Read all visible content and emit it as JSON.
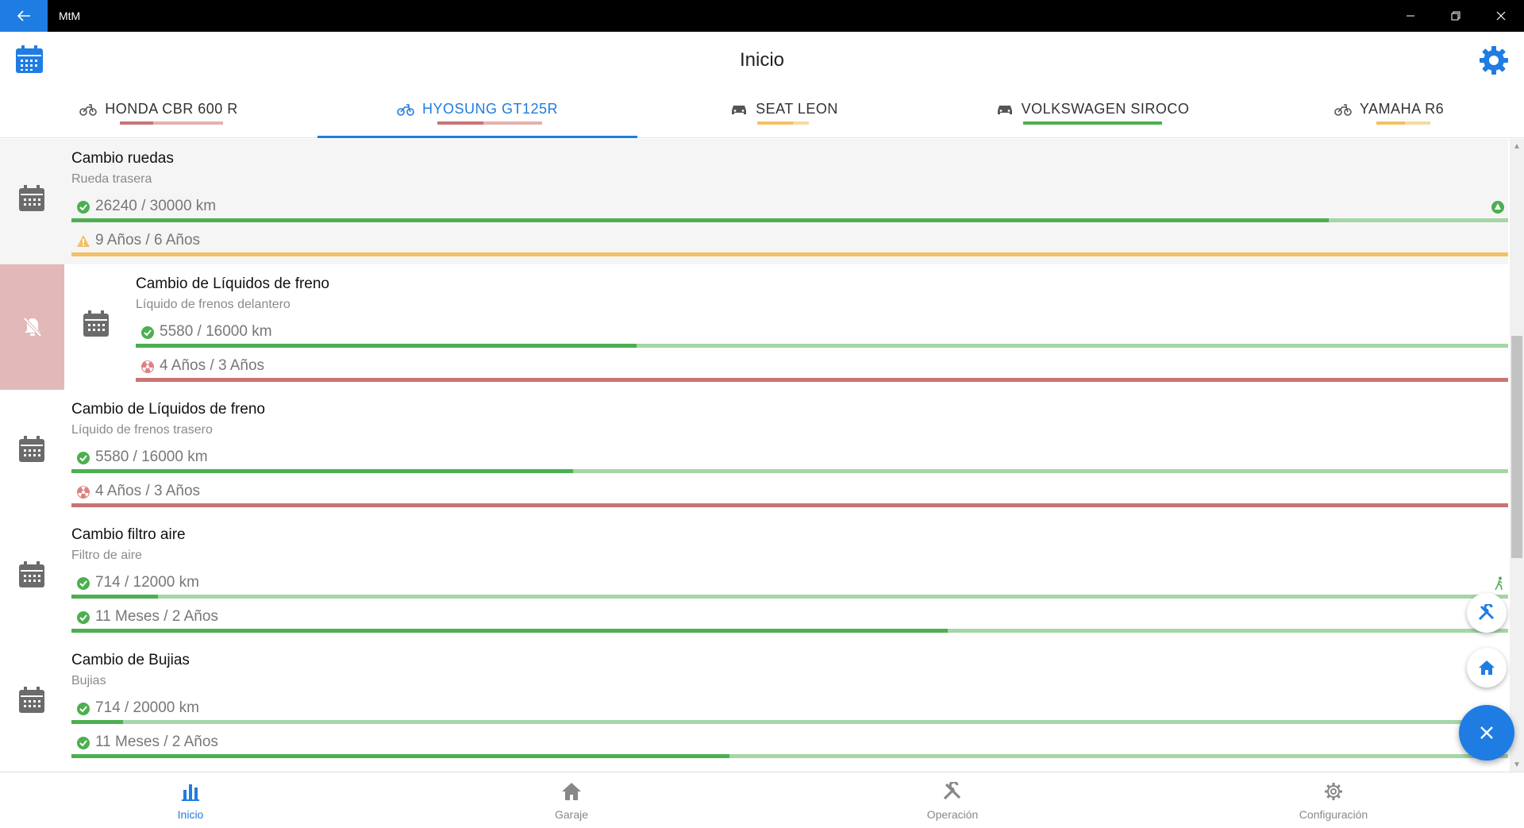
{
  "window": {
    "title": "MtM"
  },
  "header": {
    "title": "Inicio"
  },
  "colors": {
    "accent": "#1f7ce3",
    "ok": "#4caf50",
    "ok_light": "#a5d6a7",
    "warn": "#f4c064",
    "warn_light": "#f7d9a3",
    "danger": "#c87474",
    "danger_light": "#e5b1b1"
  },
  "tabs": [
    {
      "label": "HONDA CBR 600 R",
      "icon": "motorcycle-icon",
      "active": false
    },
    {
      "label": "HYOSUNG GT125R",
      "icon": "motorcycle-icon",
      "active": true
    },
    {
      "label": "SEAT LEON",
      "icon": "car-icon",
      "active": false
    },
    {
      "label": "VOLKSWAGEN SIROCO",
      "icon": "car-icon",
      "active": false
    },
    {
      "label": "YAMAHA R6",
      "icon": "motorcycle-icon",
      "active": false
    }
  ],
  "items": [
    {
      "title": "Cambio ruedas",
      "subtitle": "Rueda trasera",
      "km": {
        "text": "26240 / 30000 km",
        "status": "ok",
        "progress": 0.875
      },
      "time": {
        "text": "9 Años / 6 Años",
        "status": "warn",
        "progress": 1.0
      }
    },
    {
      "title": "Cambio de Líquidos de freno",
      "subtitle": "Líquido de frenos delantero",
      "km": {
        "text": "5580 / 16000 km",
        "status": "ok",
        "progress": 0.365
      },
      "time": {
        "text": "4 Años / 3 Años",
        "status": "danger",
        "progress": 1.0
      }
    },
    {
      "title": "Cambio de Líquidos de freno",
      "subtitle": "Líquido de frenos trasero",
      "km": {
        "text": "5580 / 16000 km",
        "status": "ok",
        "progress": 0.349
      },
      "time": {
        "text": "4 Años / 3 Años",
        "status": "danger",
        "progress": 1.0
      }
    },
    {
      "title": "Cambio filtro aire",
      "subtitle": "Filtro de aire",
      "km": {
        "text": "714 / 12000 km",
        "status": "ok",
        "progress": 0.06
      },
      "time": {
        "text": "11 Meses / 2 Años",
        "status": "ok",
        "progress": 0.61
      }
    },
    {
      "title": "Cambio de Bujias",
      "subtitle": "Bujias",
      "km": {
        "text": "714 / 20000 km",
        "status": "ok",
        "progress": 0.036
      },
      "time": {
        "text": "11 Meses / 2 Años",
        "status": "ok",
        "progress": 0.458
      }
    }
  ],
  "bottom_nav": [
    {
      "label": "Inicio",
      "icon": "bar-chart-icon",
      "active": true
    },
    {
      "label": "Garaje",
      "icon": "home-icon",
      "active": false
    },
    {
      "label": "Operación",
      "icon": "tools-icon",
      "active": false
    },
    {
      "label": "Configuración",
      "icon": "gear-icon",
      "active": false
    }
  ],
  "fab": {
    "main_icon": "close-icon",
    "actions": [
      "tools-icon",
      "home-icon"
    ]
  }
}
